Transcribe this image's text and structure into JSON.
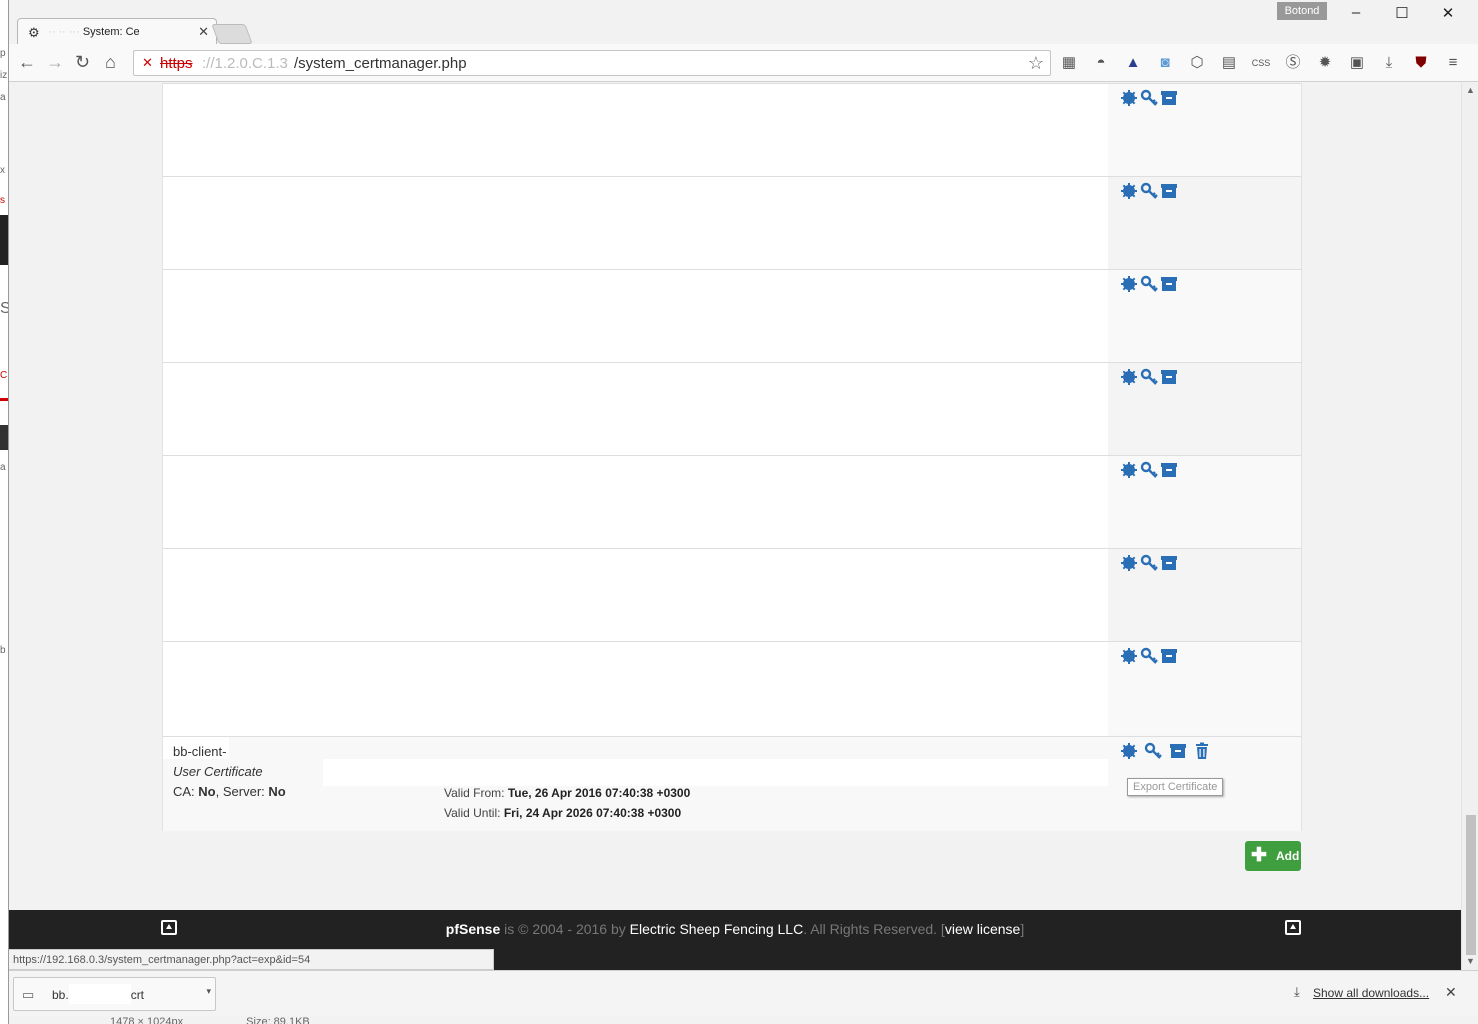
{
  "browser": {
    "tab_title": "System: Ce",
    "tab_favicon": "pfsense-favicon",
    "profile_name": "Botond",
    "url_scheme": "https",
    "url_host_masked": "://1.2.0.C.1.3",
    "url_path": "/system_certmanager.php",
    "window_controls": [
      "–",
      "☐",
      "✕"
    ]
  },
  "extensions": [
    "qr-code-icon",
    "incognito-glasses-icon",
    "stylish-icon",
    "camera-icon",
    "cube-icon",
    "image-icon",
    "css-icon",
    "skype-icon",
    "gear-icon",
    "document-icon",
    "download-arrow-icon",
    "ublock-icon",
    "menu-icon"
  ],
  "cert_rows_count": 7,
  "last_cert": {
    "name": "bb-client-",
    "type": "User Certificate",
    "ca_label": "CA:",
    "ca_value": "No",
    "server_label": "Server:",
    "server_value": "No",
    "valid_from_label": "Valid From:",
    "valid_from": "Tue, 26 Apr 2016 07:40:38 +0300",
    "valid_until_label": "Valid Until:",
    "valid_until": "Fri, 24 Apr 2026 07:40:38 +0300"
  },
  "tooltip": "Export Certificate",
  "add_button": {
    "icon": "plus-icon",
    "label": "Add"
  },
  "footer": {
    "brand": "pfSense",
    "middle": " is © 2004 - 2016 by ",
    "company": "Electric Sheep Fencing LLC",
    "rights": ". All Rights Reserved. [",
    "license_link": "view license",
    "close_bracket": "]"
  },
  "status_url": "https://192.168.0.3/system_certmanager.php?act=exp&id=54",
  "downloads": {
    "file_prefix": "bb.",
    "file_suffix": "crt",
    "show_all": "Show all downloads...",
    "close": "✕"
  },
  "under_strip": {
    "dimensions": "1478 × 1024px",
    "size": "Size: 89.1KB"
  },
  "colors": {
    "icon_blue": "#2a6fb5",
    "add_green": "#3f9f3f",
    "footer_bg": "#222222"
  }
}
